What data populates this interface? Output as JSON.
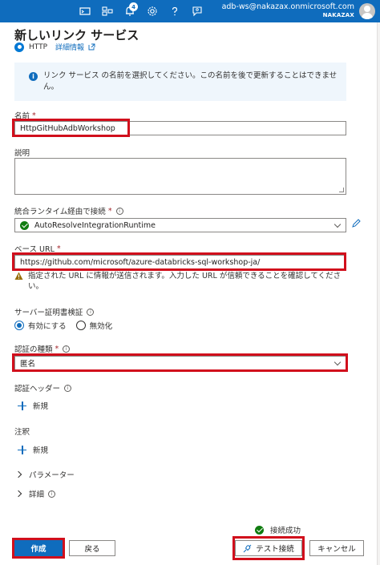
{
  "topbar": {
    "notification_count": "4",
    "account_email": "adb-ws@nakazax.onmicrosoft.com",
    "account_tenant": "NAKAZAX",
    "icons": [
      "cloud-shell-icon",
      "directory-filter-icon",
      "bell-icon",
      "gear-icon",
      "help-icon",
      "feedback-icon"
    ]
  },
  "header": {
    "title": "新しいリンク サービス",
    "protocol": "HTTP",
    "detail_link": "詳細情報"
  },
  "info": {
    "text": "リンク サービス の名前を選択してください。この名前を後で更新することはできません。"
  },
  "form": {
    "name_label": "名前",
    "name_value": "HttpGitHubAdbWorkshop",
    "description_label": "説明",
    "description_value": "",
    "runtime_label": "統合ランタイム経由で接続",
    "runtime_value": "AutoResolveIntegrationRuntime",
    "base_url_label": "ベース URL",
    "base_url_value": "https://github.com/microsoft/azure-databricks-sql-workshop-ja/",
    "base_url_warning": "指定された URL に情報が送信されます。入力した URL が信頼できることを確認してください。",
    "cert_label": "サーバー証明書検証",
    "cert_options": [
      "有効にする",
      "無効化"
    ],
    "cert_selected": "有効にする",
    "auth_label": "認証の種類",
    "auth_value": "匿名",
    "auth_headers_label": "認証ヘッダー",
    "add_new_label": "新規",
    "annotations_label": "注釈",
    "parameters_label": "パラメーター",
    "advanced_label": "詳細"
  },
  "footer": {
    "status_text": "接続成功",
    "create_label": "作成",
    "back_label": "戻る",
    "test_connection_label": "テスト接続",
    "cancel_label": "キャンセル"
  },
  "colors": {
    "accent": "#0f6cbd",
    "highlight_box": "#d10f1c",
    "success": "#107c10",
    "warning": "#986f0b"
  }
}
